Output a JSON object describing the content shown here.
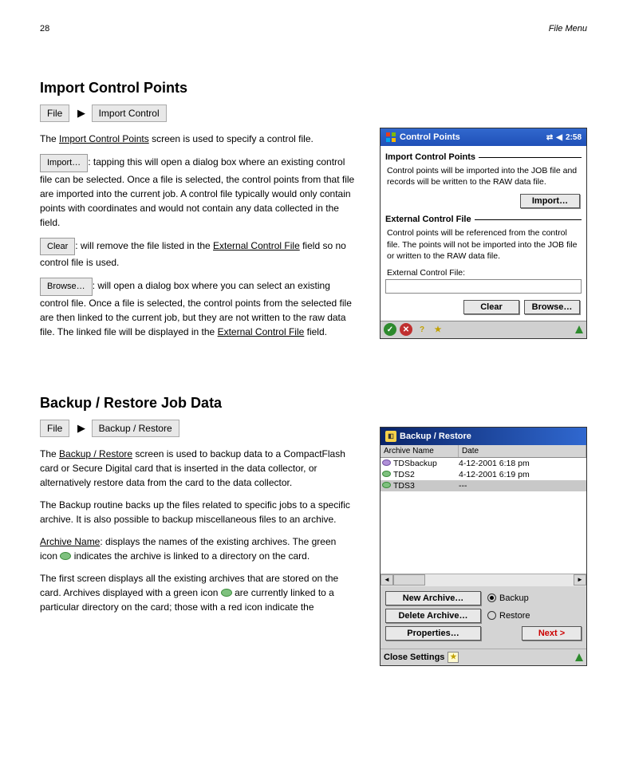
{
  "page_number": "28",
  "chapter_ref": "File Menu",
  "section_import": {
    "heading": "Import Control Points",
    "menu_path": {
      "btn1": "File",
      "arrow": "▶",
      "btn2": "Import Control"
    },
    "para1_prefix": "The ",
    "para1_link": "Import Control Points",
    "para1_suffix": " screen is used to specify a control file.",
    "import_btn": "Import…",
    "para2": ": tapping this will open a dialog box where an existing control file can be selected. Once a file is selected, the control points from that file are imported into the current job. A control file typically would only contain points with coordinates and would not contain any data collected in the field.",
    "clear_btn": "Clear",
    "clear_text_prefix": ": will remove the file listed in the ",
    "clear_text_link": "External Control File",
    "clear_text_suffix": " field so no control file is used.",
    "browse_btn": "Browse…",
    "browse_text_prefix": ": will open a dialog box where you can select an existing control file. Once a file is selected, the control points from the selected file are then linked to the current job, but they are not written to the raw data file. The linked file will be displayed in the ",
    "browse_text_link": "External Control File",
    "browse_text_suffix": " field."
  },
  "device_control": {
    "title": "Control Points",
    "clock": "2:58",
    "h1": "Import Control Points",
    "p1": "Control points will be imported into the JOB file and records will be written to the RAW data file.",
    "btn_import": "Import…",
    "h2": "External Control File",
    "p2": "Control points will be referenced from the control file. The points will not be imported into the JOB file or written to the RAW data file.",
    "label": "External Control File:",
    "btn_clear": "Clear",
    "btn_browse": "Browse…"
  },
  "section_backup": {
    "heading": "Backup / Restore Job Data",
    "menu_path": {
      "btn1": "File",
      "arrow": "▶",
      "btn2": "Backup / Restore"
    },
    "para1_prefix": "The ",
    "para1_link": "Backup / Restore",
    "para1_suffix": " screen is used to backup data to a CompactFlash card or Secure Digital card that is inserted in the data collector, or alternatively restore data from the card to the data collector.",
    "para2": "The Backup routine backs up the files related to specific jobs to a specific archive. It is also possible to backup miscellaneous files to an archive.",
    "para3_prefix": "The first screen displays all the existing archives that are stored on the card. Archives displayed with a green icon ",
    "para3_suffix": " are currently linked to a particular directory on the card; those with a red icon indicate the",
    "archive_header": "Archive Name",
    "para4_prefix": ": displays the names of the existing archives. The green icon ",
    "para4_suffix": " indicates the archive is linked to a directory on the card."
  },
  "device_backup": {
    "title": "Backup / Restore",
    "col_name": "Archive Name",
    "col_date": "Date",
    "rows": [
      {
        "name": "TDSbackup",
        "date": "4-12-2001  6:18 pm",
        "iconClass": "disk-purple"
      },
      {
        "name": "TDS2",
        "date": "4-12-2001  6:19 pm",
        "iconClass": "disk-green"
      },
      {
        "name": "TDS3",
        "date": "---",
        "iconClass": "disk-green",
        "selected": true
      }
    ],
    "btn_new": "New Archive…",
    "btn_delete": "Delete Archive…",
    "btn_props": "Properties…",
    "radio_backup": "Backup",
    "radio_restore": "Restore",
    "btn_next": "Next >",
    "close_settings": "Close Settings"
  }
}
